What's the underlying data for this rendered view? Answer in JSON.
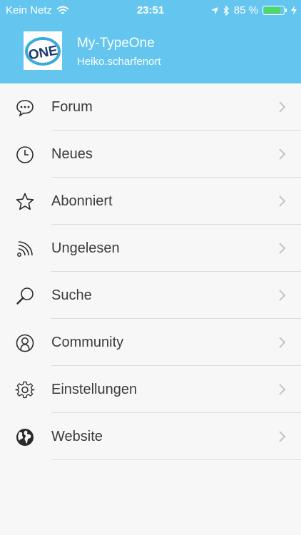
{
  "status_bar": {
    "carrier": "Kein Netz",
    "time": "23:51",
    "battery_percent_label": "85 %",
    "battery_level": 0.85
  },
  "profile": {
    "avatar_text": "ONE",
    "title": "My-TypeOne",
    "username": "Heiko.scharfenort"
  },
  "menu": {
    "items": [
      {
        "label": "Forum",
        "icon": "chat-bubble-icon"
      },
      {
        "label": "Neues",
        "icon": "clock-icon"
      },
      {
        "label": "Abonniert",
        "icon": "star-icon"
      },
      {
        "label": "Ungelesen",
        "icon": "rss-icon"
      },
      {
        "label": "Suche",
        "icon": "search-icon"
      },
      {
        "label": "Community",
        "icon": "person-icon"
      },
      {
        "label": "Einstellungen",
        "icon": "gear-icon"
      },
      {
        "label": "Website",
        "icon": "globe-icon"
      }
    ]
  },
  "colors": {
    "header": "#64c6ef",
    "background": "#f7f7f7",
    "battery": "#4cd964"
  }
}
